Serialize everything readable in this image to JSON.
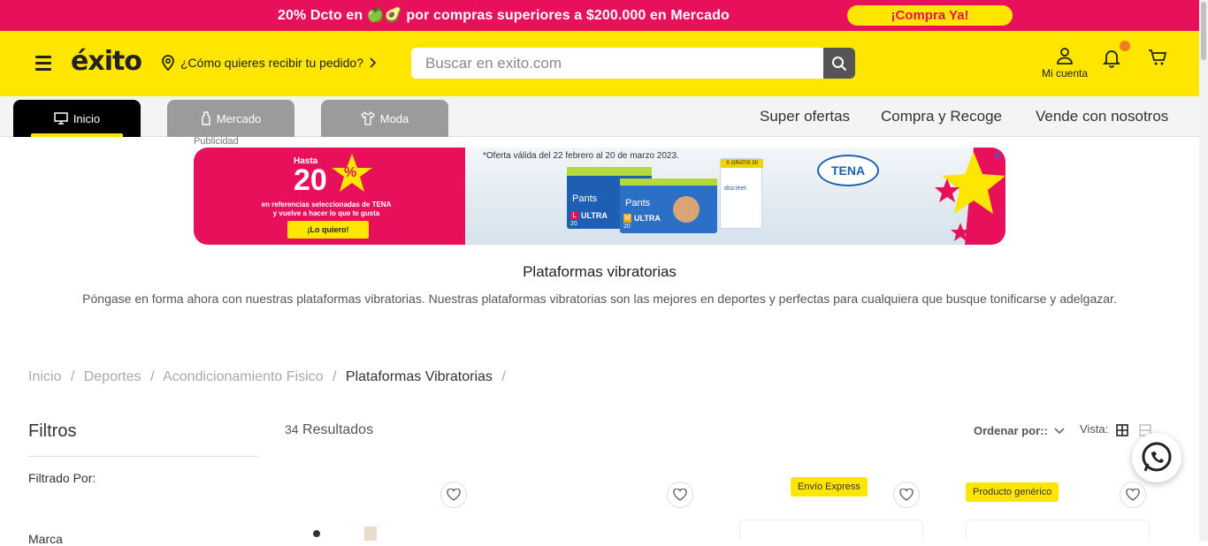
{
  "promo": {
    "text": "20% Dcto en 🍏🥑 por compras superiores a $200.000 en Mercado",
    "cta": "¡Compra Ya!",
    "bg_color": "#e8105a",
    "cta_color": "#ffe600"
  },
  "header": {
    "logo": "éxito",
    "delivery_prompt": "¿Cómo quieres recibir tu pedido?",
    "search_placeholder": "Buscar en exito.com",
    "account_label": "Mi cuenta",
    "brand_color": "#ffe600"
  },
  "nav": {
    "tabs": [
      {
        "label": "Inicio",
        "icon": "monitor-icon",
        "active": true
      },
      {
        "label": "Mercado",
        "icon": "bottle-icon",
        "active": false
      },
      {
        "label": "Moda",
        "icon": "shirt-icon",
        "active": false
      }
    ],
    "links": [
      "Super ofertas",
      "Compra y Recoge",
      "Vende con nosotros"
    ]
  },
  "ad": {
    "label": "Publicidad",
    "hasta": "Hasta",
    "discount": "20",
    "percent": "%",
    "line1": "en referencias seleccionadas de TENA",
    "line2": "y vuelve a hacer lo que te gusta",
    "button": "¡Lo quiero!",
    "validity": "*Oferta válida del 22 febrero al 20 de marzo 2023.",
    "brand": "TENA",
    "pack1_name": "Pants",
    "pack1_line": "ULTRA",
    "pack2_name": "Pants",
    "pack2_line": "ULTRA",
    "pack1_size": "L",
    "pack2_size": "M",
    "pack_count": "20",
    "pack3_brand": "discreet",
    "pack3_tag": "X GRATIS 30"
  },
  "category": {
    "title": "Plataformas vibratorias",
    "description": "Póngase en forma ahora con nuestras plataformas vibratorias. Nuestras plataformas vibratorias son las mejores en deportes y perfectas para cualquiera que busque tonificarse y adelgazar."
  },
  "breadcrumb": {
    "items": [
      "Inicio",
      "Deportes",
      "Acondicionamiento Fisico"
    ],
    "current": "Plataformas Vibratorias",
    "separator": "/"
  },
  "filters": {
    "title": "Filtros",
    "filtered_by": "Filtrado Por:",
    "marca": "Marca"
  },
  "results": {
    "count": "34",
    "label": "Resultados",
    "sort_label": "Ordenar por::",
    "view_label": "Vista:"
  },
  "products": {
    "badges": [
      "Envío Express",
      "Producto genérico"
    ]
  }
}
